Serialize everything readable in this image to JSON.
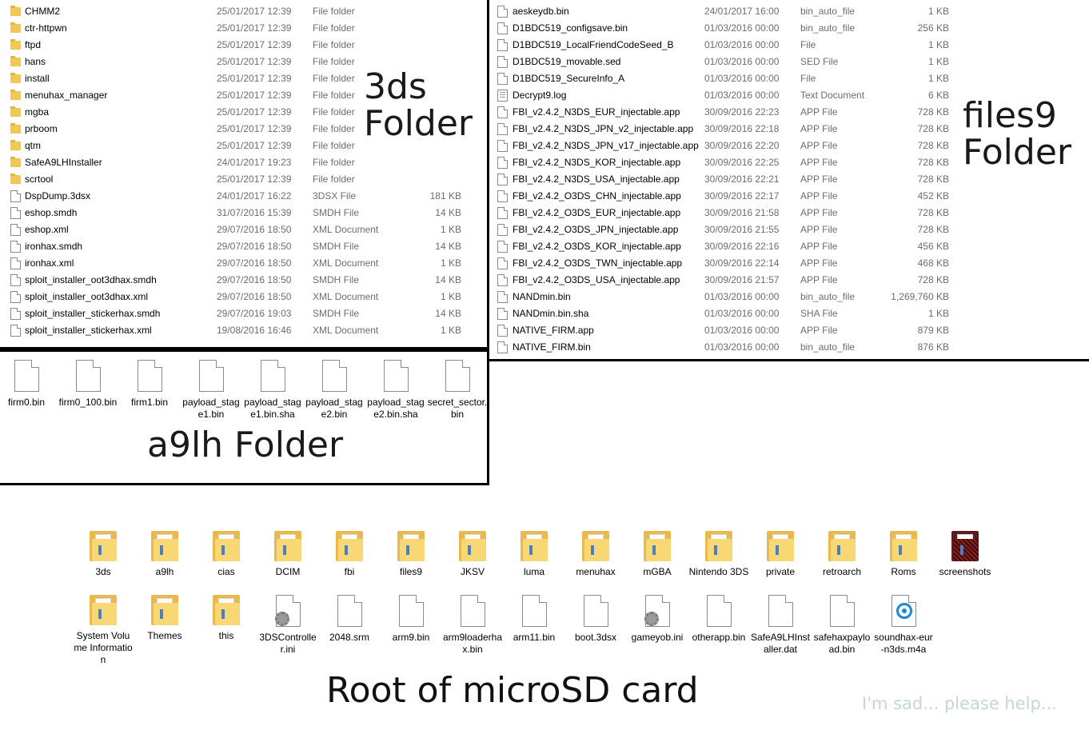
{
  "panel_3ds": {
    "label": "3ds\nFolder",
    "rows": [
      {
        "icon": "folder-icon",
        "name": "CHMM2",
        "date": "25/01/2017 12:39",
        "type": "File folder",
        "size": ""
      },
      {
        "icon": "folder-icon",
        "name": "ctr-httpwn",
        "date": "25/01/2017 12:39",
        "type": "File folder",
        "size": ""
      },
      {
        "icon": "folder-icon",
        "name": "ftpd",
        "date": "25/01/2017 12:39",
        "type": "File folder",
        "size": ""
      },
      {
        "icon": "folder-icon",
        "name": "hans",
        "date": "25/01/2017 12:39",
        "type": "File folder",
        "size": ""
      },
      {
        "icon": "folder-icon",
        "name": "install",
        "date": "25/01/2017 12:39",
        "type": "File folder",
        "size": ""
      },
      {
        "icon": "folder-icon",
        "name": "menuhax_manager",
        "date": "25/01/2017 12:39",
        "type": "File folder",
        "size": ""
      },
      {
        "icon": "folder-icon",
        "name": "mgba",
        "date": "25/01/2017 12:39",
        "type": "File folder",
        "size": ""
      },
      {
        "icon": "folder-icon",
        "name": "prboom",
        "date": "25/01/2017 12:39",
        "type": "File folder",
        "size": ""
      },
      {
        "icon": "folder-icon",
        "name": "qtm",
        "date": "25/01/2017 12:39",
        "type": "File folder",
        "size": ""
      },
      {
        "icon": "folder-icon",
        "name": "SafeA9LHInstaller",
        "date": "24/01/2017 19:23",
        "type": "File folder",
        "size": ""
      },
      {
        "icon": "folder-icon",
        "name": "scrtool",
        "date": "25/01/2017 12:39",
        "type": "File folder",
        "size": ""
      },
      {
        "icon": "file-icon",
        "name": "DspDump.3dsx",
        "date": "24/01/2017 16:22",
        "type": "3DSX File",
        "size": "181 KB"
      },
      {
        "icon": "file-icon",
        "name": "eshop.smdh",
        "date": "31/07/2016 15:39",
        "type": "SMDH File",
        "size": "14 KB"
      },
      {
        "icon": "file-icon",
        "name": "eshop.xml",
        "date": "29/07/2016 18:50",
        "type": "XML Document",
        "size": "1 KB"
      },
      {
        "icon": "file-icon",
        "name": "ironhax.smdh",
        "date": "29/07/2016 18:50",
        "type": "SMDH File",
        "size": "14 KB"
      },
      {
        "icon": "file-icon",
        "name": "ironhax.xml",
        "date": "29/07/2016 18:50",
        "type": "XML Document",
        "size": "1 KB"
      },
      {
        "icon": "file-icon",
        "name": "sploit_installer_oot3dhax.smdh",
        "date": "29/07/2016 18:50",
        "type": "SMDH File",
        "size": "14 KB"
      },
      {
        "icon": "file-icon",
        "name": "sploit_installer_oot3dhax.xml",
        "date": "29/07/2016 18:50",
        "type": "XML Document",
        "size": "1 KB"
      },
      {
        "icon": "file-icon",
        "name": "sploit_installer_stickerhax.smdh",
        "date": "29/07/2016 19:03",
        "type": "SMDH File",
        "size": "14 KB"
      },
      {
        "icon": "file-icon",
        "name": "sploit_installer_stickerhax.xml",
        "date": "19/08/2016 16:46",
        "type": "XML Document",
        "size": "1 KB"
      }
    ]
  },
  "panel_files9": {
    "label": "files9\nFolder",
    "rows": [
      {
        "icon": "file-icon",
        "name": "aeskeydb.bin",
        "date": "24/01/2017 16:00",
        "type": "bin_auto_file",
        "size": "1 KB"
      },
      {
        "icon": "file-icon",
        "name": "D1BDC519_configsave.bin",
        "date": "01/03/2016 00:00",
        "type": "bin_auto_file",
        "size": "256 KB"
      },
      {
        "icon": "file-icon",
        "name": "D1BDC519_LocalFriendCodeSeed_B",
        "date": "01/03/2016 00:00",
        "type": "File",
        "size": "1 KB"
      },
      {
        "icon": "file-icon",
        "name": "D1BDC519_movable.sed",
        "date": "01/03/2016 00:00",
        "type": "SED File",
        "size": "1 KB"
      },
      {
        "icon": "file-icon",
        "name": "D1BDC519_SecureInfo_A",
        "date": "01/03/2016 00:00",
        "type": "File",
        "size": "1 KB"
      },
      {
        "icon": "text-file-icon",
        "name": "Decrypt9.log",
        "date": "01/03/2016 00:00",
        "type": "Text Document",
        "size": "6 KB"
      },
      {
        "icon": "file-icon",
        "name": "FBI_v2.4.2_N3DS_EUR_injectable.app",
        "date": "30/09/2016 22:23",
        "type": "APP File",
        "size": "728 KB"
      },
      {
        "icon": "file-icon",
        "name": "FBI_v2.4.2_N3DS_JPN_v2_injectable.app",
        "date": "30/09/2016 22:18",
        "type": "APP File",
        "size": "728 KB"
      },
      {
        "icon": "file-icon",
        "name": "FBI_v2.4.2_N3DS_JPN_v17_injectable.app",
        "date": "30/09/2016 22:20",
        "type": "APP File",
        "size": "728 KB"
      },
      {
        "icon": "file-icon",
        "name": "FBI_v2.4.2_N3DS_KOR_injectable.app",
        "date": "30/09/2016 22:25",
        "type": "APP File",
        "size": "728 KB"
      },
      {
        "icon": "file-icon",
        "name": "FBI_v2.4.2_N3DS_USA_injectable.app",
        "date": "30/09/2016 22:21",
        "type": "APP File",
        "size": "728 KB"
      },
      {
        "icon": "file-icon",
        "name": "FBI_v2.4.2_O3DS_CHN_injectable.app",
        "date": "30/09/2016 22:17",
        "type": "APP File",
        "size": "452 KB"
      },
      {
        "icon": "file-icon",
        "name": "FBI_v2.4.2_O3DS_EUR_injectable.app",
        "date": "30/09/2016 21:58",
        "type": "APP File",
        "size": "728 KB"
      },
      {
        "icon": "file-icon",
        "name": "FBI_v2.4.2_O3DS_JPN_injectable.app",
        "date": "30/09/2016 21:55",
        "type": "APP File",
        "size": "728 KB"
      },
      {
        "icon": "file-icon",
        "name": "FBI_v2.4.2_O3DS_KOR_injectable.app",
        "date": "30/09/2016 22:16",
        "type": "APP File",
        "size": "456 KB"
      },
      {
        "icon": "file-icon",
        "name": "FBI_v2.4.2_O3DS_TWN_injectable.app",
        "date": "30/09/2016 22:14",
        "type": "APP File",
        "size": "468 KB"
      },
      {
        "icon": "file-icon",
        "name": "FBI_v2.4.2_O3DS_USA_injectable.app",
        "date": "30/09/2016 21:57",
        "type": "APP File",
        "size": "728 KB"
      },
      {
        "icon": "file-icon",
        "name": "NANDmin.bin",
        "date": "01/03/2016 00:00",
        "type": "bin_auto_file",
        "size": "1,269,760 KB"
      },
      {
        "icon": "file-icon",
        "name": "NANDmin.bin.sha",
        "date": "01/03/2016 00:00",
        "type": "SHA File",
        "size": "1 KB"
      },
      {
        "icon": "file-icon",
        "name": "NATIVE_FIRM.app",
        "date": "01/03/2016 00:00",
        "type": "APP File",
        "size": "879 KB"
      },
      {
        "icon": "file-icon",
        "name": "NATIVE_FIRM.bin",
        "date": "01/03/2016 00:00",
        "type": "bin_auto_file",
        "size": "876 KB"
      }
    ]
  },
  "panel_a9lh": {
    "label": "a9lh Folder",
    "items": [
      {
        "icon": "file-icon",
        "label": "firm0.bin"
      },
      {
        "icon": "file-icon",
        "label": "firm0_100.bin"
      },
      {
        "icon": "file-icon",
        "label": "firm1.bin"
      },
      {
        "icon": "file-icon",
        "label": "payload_stage1.bin"
      },
      {
        "icon": "file-icon",
        "label": "payload_stage1.bin.sha"
      },
      {
        "icon": "file-icon",
        "label": "payload_stage2.bin"
      },
      {
        "icon": "file-icon",
        "label": "payload_stage2.bin.sha"
      },
      {
        "icon": "file-icon",
        "label": "secret_sector.bin"
      }
    ]
  },
  "root": {
    "label": "Root of microSD card",
    "note": "I'm sad... please help...",
    "items": [
      {
        "icon": "folder-icon",
        "label": "3ds"
      },
      {
        "icon": "folder-icon",
        "label": "a9lh"
      },
      {
        "icon": "folder-icon",
        "label": "cias"
      },
      {
        "icon": "folder-icon",
        "label": "DCIM"
      },
      {
        "icon": "folder-icon",
        "label": "fbi"
      },
      {
        "icon": "folder-icon",
        "label": "files9"
      },
      {
        "icon": "folder-icon",
        "label": "JKSV"
      },
      {
        "icon": "folder-icon",
        "label": "luma"
      },
      {
        "icon": "folder-icon",
        "label": "menuhax"
      },
      {
        "icon": "folder-icon",
        "label": "mGBA"
      },
      {
        "icon": "folder-icon",
        "label": "Nintendo 3DS"
      },
      {
        "icon": "folder-icon",
        "label": "private"
      },
      {
        "icon": "folder-icon",
        "label": "retroarch"
      },
      {
        "icon": "folder-icon",
        "label": "Roms"
      },
      {
        "icon": "image-folder-icon",
        "label": "screenshots"
      },
      {
        "icon": "folder-icon",
        "label": "System Volume Information"
      },
      {
        "icon": "folder-icon",
        "label": "Themes"
      },
      {
        "icon": "folder-icon",
        "label": "this"
      },
      {
        "icon": "settings-file-icon",
        "label": "3DSController.ini"
      },
      {
        "icon": "file-icon",
        "label": "2048.srm"
      },
      {
        "icon": "file-icon",
        "label": "arm9.bin"
      },
      {
        "icon": "file-icon",
        "label": "arm9loaderhax.bin"
      },
      {
        "icon": "file-icon",
        "label": "arm11.bin"
      },
      {
        "icon": "file-icon",
        "label": "boot.3dsx"
      },
      {
        "icon": "settings-file-icon",
        "label": "gameyob.ini"
      },
      {
        "icon": "file-icon",
        "label": "otherapp.bin"
      },
      {
        "icon": "file-icon",
        "label": "SafeA9LHInstaller.dat"
      },
      {
        "icon": "file-icon",
        "label": "safehaxpayload.bin"
      },
      {
        "icon": "media-file-icon",
        "label": "soundhax-eur-n3ds.m4a"
      }
    ]
  }
}
